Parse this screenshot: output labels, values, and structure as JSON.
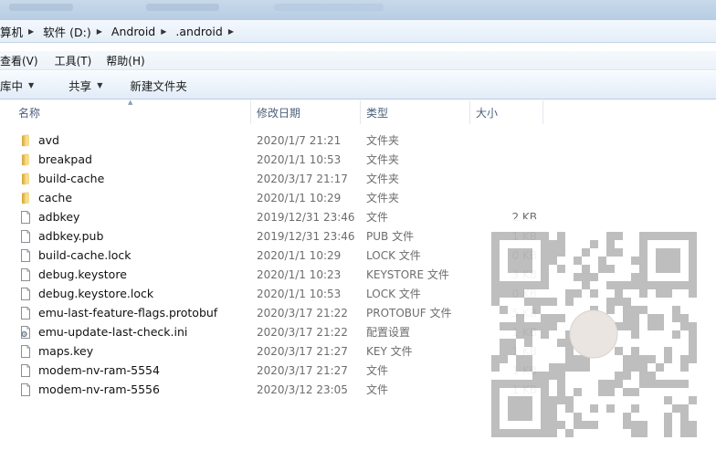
{
  "address": {
    "crumbs": [
      {
        "label": "算机"
      },
      {
        "label": "软件 (D:)"
      },
      {
        "label": "Android"
      },
      {
        "label": ".android"
      }
    ]
  },
  "menu": {
    "items": [
      {
        "label": "查看(V)"
      },
      {
        "label": "工具(T)"
      },
      {
        "label": "帮助(H)"
      }
    ]
  },
  "toolbar": {
    "library_label": "库中",
    "share_label": "共享",
    "new_folder_label": "新建文件夹"
  },
  "columns": {
    "name": "名称",
    "date": "修改日期",
    "type": "类型",
    "size": "大小"
  },
  "files": [
    {
      "name": "avd",
      "date": "2020/1/7 21:21",
      "type": "文件夹",
      "size": "",
      "icon": "folder-icon"
    },
    {
      "name": "breakpad",
      "date": "2020/1/1 10:53",
      "type": "文件夹",
      "size": "",
      "icon": "folder-icon"
    },
    {
      "name": "build-cache",
      "date": "2020/3/17 21:17",
      "type": "文件夹",
      "size": "",
      "icon": "folder-icon"
    },
    {
      "name": "cache",
      "date": "2020/1/1 10:29",
      "type": "文件夹",
      "size": "",
      "icon": "folder-icon"
    },
    {
      "name": "adbkey",
      "date": "2019/12/31 23:46",
      "type": "文件",
      "size": "2 KB",
      "icon": "file-icon"
    },
    {
      "name": "adbkey.pub",
      "date": "2019/12/31 23:46",
      "type": "PUB 文件",
      "size": "1 KB",
      "icon": "file-icon"
    },
    {
      "name": "build-cache.lock",
      "date": "2020/1/1 10:29",
      "type": "LOCK 文件",
      "size": "0 KB",
      "icon": "file-icon"
    },
    {
      "name": "debug.keystore",
      "date": "2020/1/1 10:23",
      "type": "KEYSTORE 文件",
      "size": "3 KB",
      "icon": "file-icon"
    },
    {
      "name": "debug.keystore.lock",
      "date": "2020/1/1 10:53",
      "type": "LOCK 文件",
      "size": "0 KB",
      "icon": "file-icon"
    },
    {
      "name": "emu-last-feature-flags.protobuf",
      "date": "2020/3/17 21:22",
      "type": "PROTOBUF 文件",
      "size": "5 KB",
      "icon": "file-icon"
    },
    {
      "name": "emu-update-last-check.ini",
      "date": "2020/3/17 21:22",
      "type": "配置设置",
      "size": "1 KB",
      "icon": "settings-file-icon"
    },
    {
      "name": "maps.key",
      "date": "2020/3/17 21:27",
      "type": "KEY 文件",
      "size": "1 KB",
      "icon": "file-icon"
    },
    {
      "name": "modem-nv-ram-5554",
      "date": "2020/3/17 21:27",
      "type": "文件",
      "size": "1 KB",
      "icon": "file-icon"
    },
    {
      "name": "modem-nv-ram-5556",
      "date": "2020/3/12 23:05",
      "type": "文件",
      "size": "1 KB",
      "icon": "file-icon"
    }
  ],
  "colors": {
    "folder": "#e8c05a",
    "header_text": "#4c607a",
    "meta_text": "#6d6d6d"
  }
}
